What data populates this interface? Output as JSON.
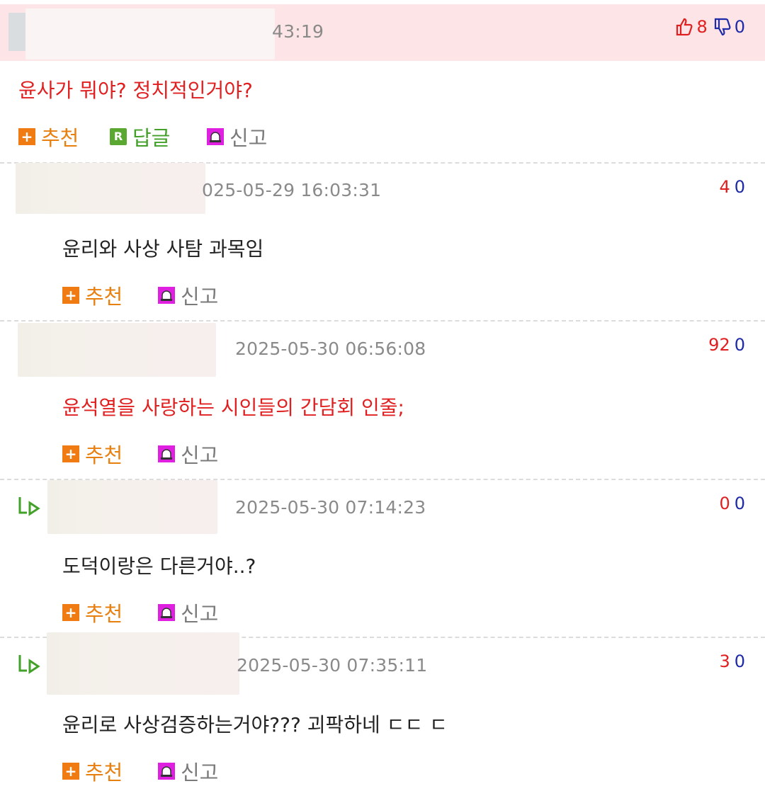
{
  "post": {
    "time_partial": "43:19",
    "votes": {
      "up": "8",
      "down": "0"
    },
    "content": "윤사가 뭐야? 정치적인거야?",
    "actions": {
      "recommend": "추천",
      "reply": "답글",
      "report": "신고"
    }
  },
  "comments": [
    {
      "date": "025-05-29 16:03:31",
      "up": "4",
      "down": "0",
      "content": "윤리와 사상 사탐 과목임",
      "recommend": "추천",
      "report": "신고"
    },
    {
      "date": "2025-05-30 06:56:08",
      "up": "92",
      "down": "0",
      "content": "윤석열을 사랑하는 시인들의 간담회 인줄;",
      "recommend": "추천",
      "report": "신고"
    },
    {
      "date": "2025-05-30 07:14:23",
      "up": "0",
      "down": "0",
      "content": "도덕이랑은 다른거야..?",
      "recommend": "추천",
      "report": "신고"
    },
    {
      "date": "2025-05-30 07:35:11",
      "up": "3",
      "down": "0",
      "content": "윤리로 사상검증하는거야??? 괴팍하네 ㄷㄷ ㄷ",
      "recommend": "추천",
      "report": "신고"
    }
  ],
  "icons": {
    "thumb_up": "thumbs-up-icon",
    "thumb_down": "thumbs-down-icon",
    "plus": "plus-icon",
    "reply_badge": "reply-r-icon",
    "report": "alarm-bell-icon",
    "nested_reply": "reply-arrow-icon"
  },
  "colors": {
    "accent_red": "#e02020",
    "down_blue": "#1e2aa8",
    "recommend_orange": "#f07b12",
    "reply_green": "#5aa832",
    "report_magenta": "#e020e0",
    "highlight_bg": "#fde4e6"
  }
}
